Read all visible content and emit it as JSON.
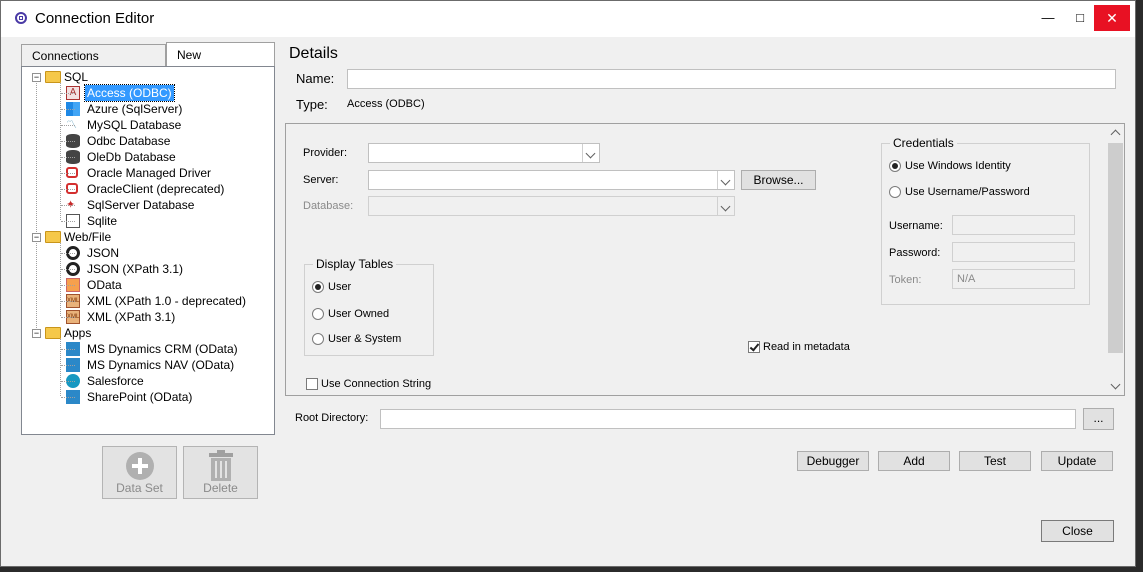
{
  "window": {
    "title": "Connection Editor",
    "minimize": "—",
    "maximize": "□",
    "close": "✕"
  },
  "tabs": [
    {
      "label": "Connections"
    },
    {
      "label": "New"
    }
  ],
  "tree": {
    "groups": [
      {
        "label": "SQL",
        "items": [
          {
            "label": "Access (ODBC)",
            "icon": "access-icon",
            "selected": true
          },
          {
            "label": "Azure (SqlServer)",
            "icon": "azure-icon"
          },
          {
            "label": "MySQL Database",
            "icon": "mysql-icon"
          },
          {
            "label": "Odbc Database",
            "icon": "database-icon"
          },
          {
            "label": "OleDb Database",
            "icon": "database-icon"
          },
          {
            "label": "Oracle Managed Driver",
            "icon": "oracle-icon"
          },
          {
            "label": "OracleClient (deprecated)",
            "icon": "oracle-icon"
          },
          {
            "label": "SqlServer Database",
            "icon": "sqlserver-icon"
          },
          {
            "label": "Sqlite",
            "icon": "sqlite-icon"
          }
        ]
      },
      {
        "label": "Web/File",
        "items": [
          {
            "label": "JSON",
            "icon": "json-icon"
          },
          {
            "label": "JSON (XPath 3.1)",
            "icon": "json-icon"
          },
          {
            "label": "OData",
            "icon": "odata-icon"
          },
          {
            "label": "XML (XPath 1.0 - deprecated)",
            "icon": "xml-icon"
          },
          {
            "label": "XML (XPath 3.1)",
            "icon": "xml-icon"
          }
        ]
      },
      {
        "label": "Apps",
        "items": [
          {
            "label": "MS Dynamics CRM (OData)",
            "icon": "dynamics-icon"
          },
          {
            "label": "MS Dynamics NAV (OData)",
            "icon": "dynamics-icon"
          },
          {
            "label": "Salesforce",
            "icon": "salesforce-icon"
          },
          {
            "label": "SharePoint (OData)",
            "icon": "sharepoint-icon"
          }
        ]
      }
    ]
  },
  "left_buttons": {
    "dataset": "Data Set",
    "delete": "Delete"
  },
  "details": {
    "heading": "Details",
    "name_label": "Name:",
    "name_value": "",
    "type_label": "Type:",
    "type_value": "Access (ODBC)",
    "provider_label": "Provider:",
    "server_label": "Server:",
    "database_label": "Database:",
    "browse_label": "Browse...",
    "display_tables": {
      "title": "Display Tables",
      "options": [
        "User",
        "User Owned",
        "User & System"
      ],
      "selected": "User"
    },
    "credentials": {
      "title": "Credentials",
      "options": [
        "Use Windows Identity",
        "Use Username/Password"
      ],
      "selected": "Use Windows Identity",
      "username_label": "Username:",
      "password_label": "Password:",
      "token_label": "Token:",
      "token_value": "N/A"
    },
    "read_metadata_label": "Read in metadata",
    "read_metadata_checked": true,
    "use_conn_string_label": "Use Connection String",
    "use_conn_string_checked": false,
    "root_dir_label": "Root Directory:",
    "root_dir_value": "",
    "ellipsis_label": "..."
  },
  "actions": {
    "debugger": "Debugger",
    "add": "Add",
    "test": "Test",
    "update": "Update",
    "close": "Close"
  }
}
